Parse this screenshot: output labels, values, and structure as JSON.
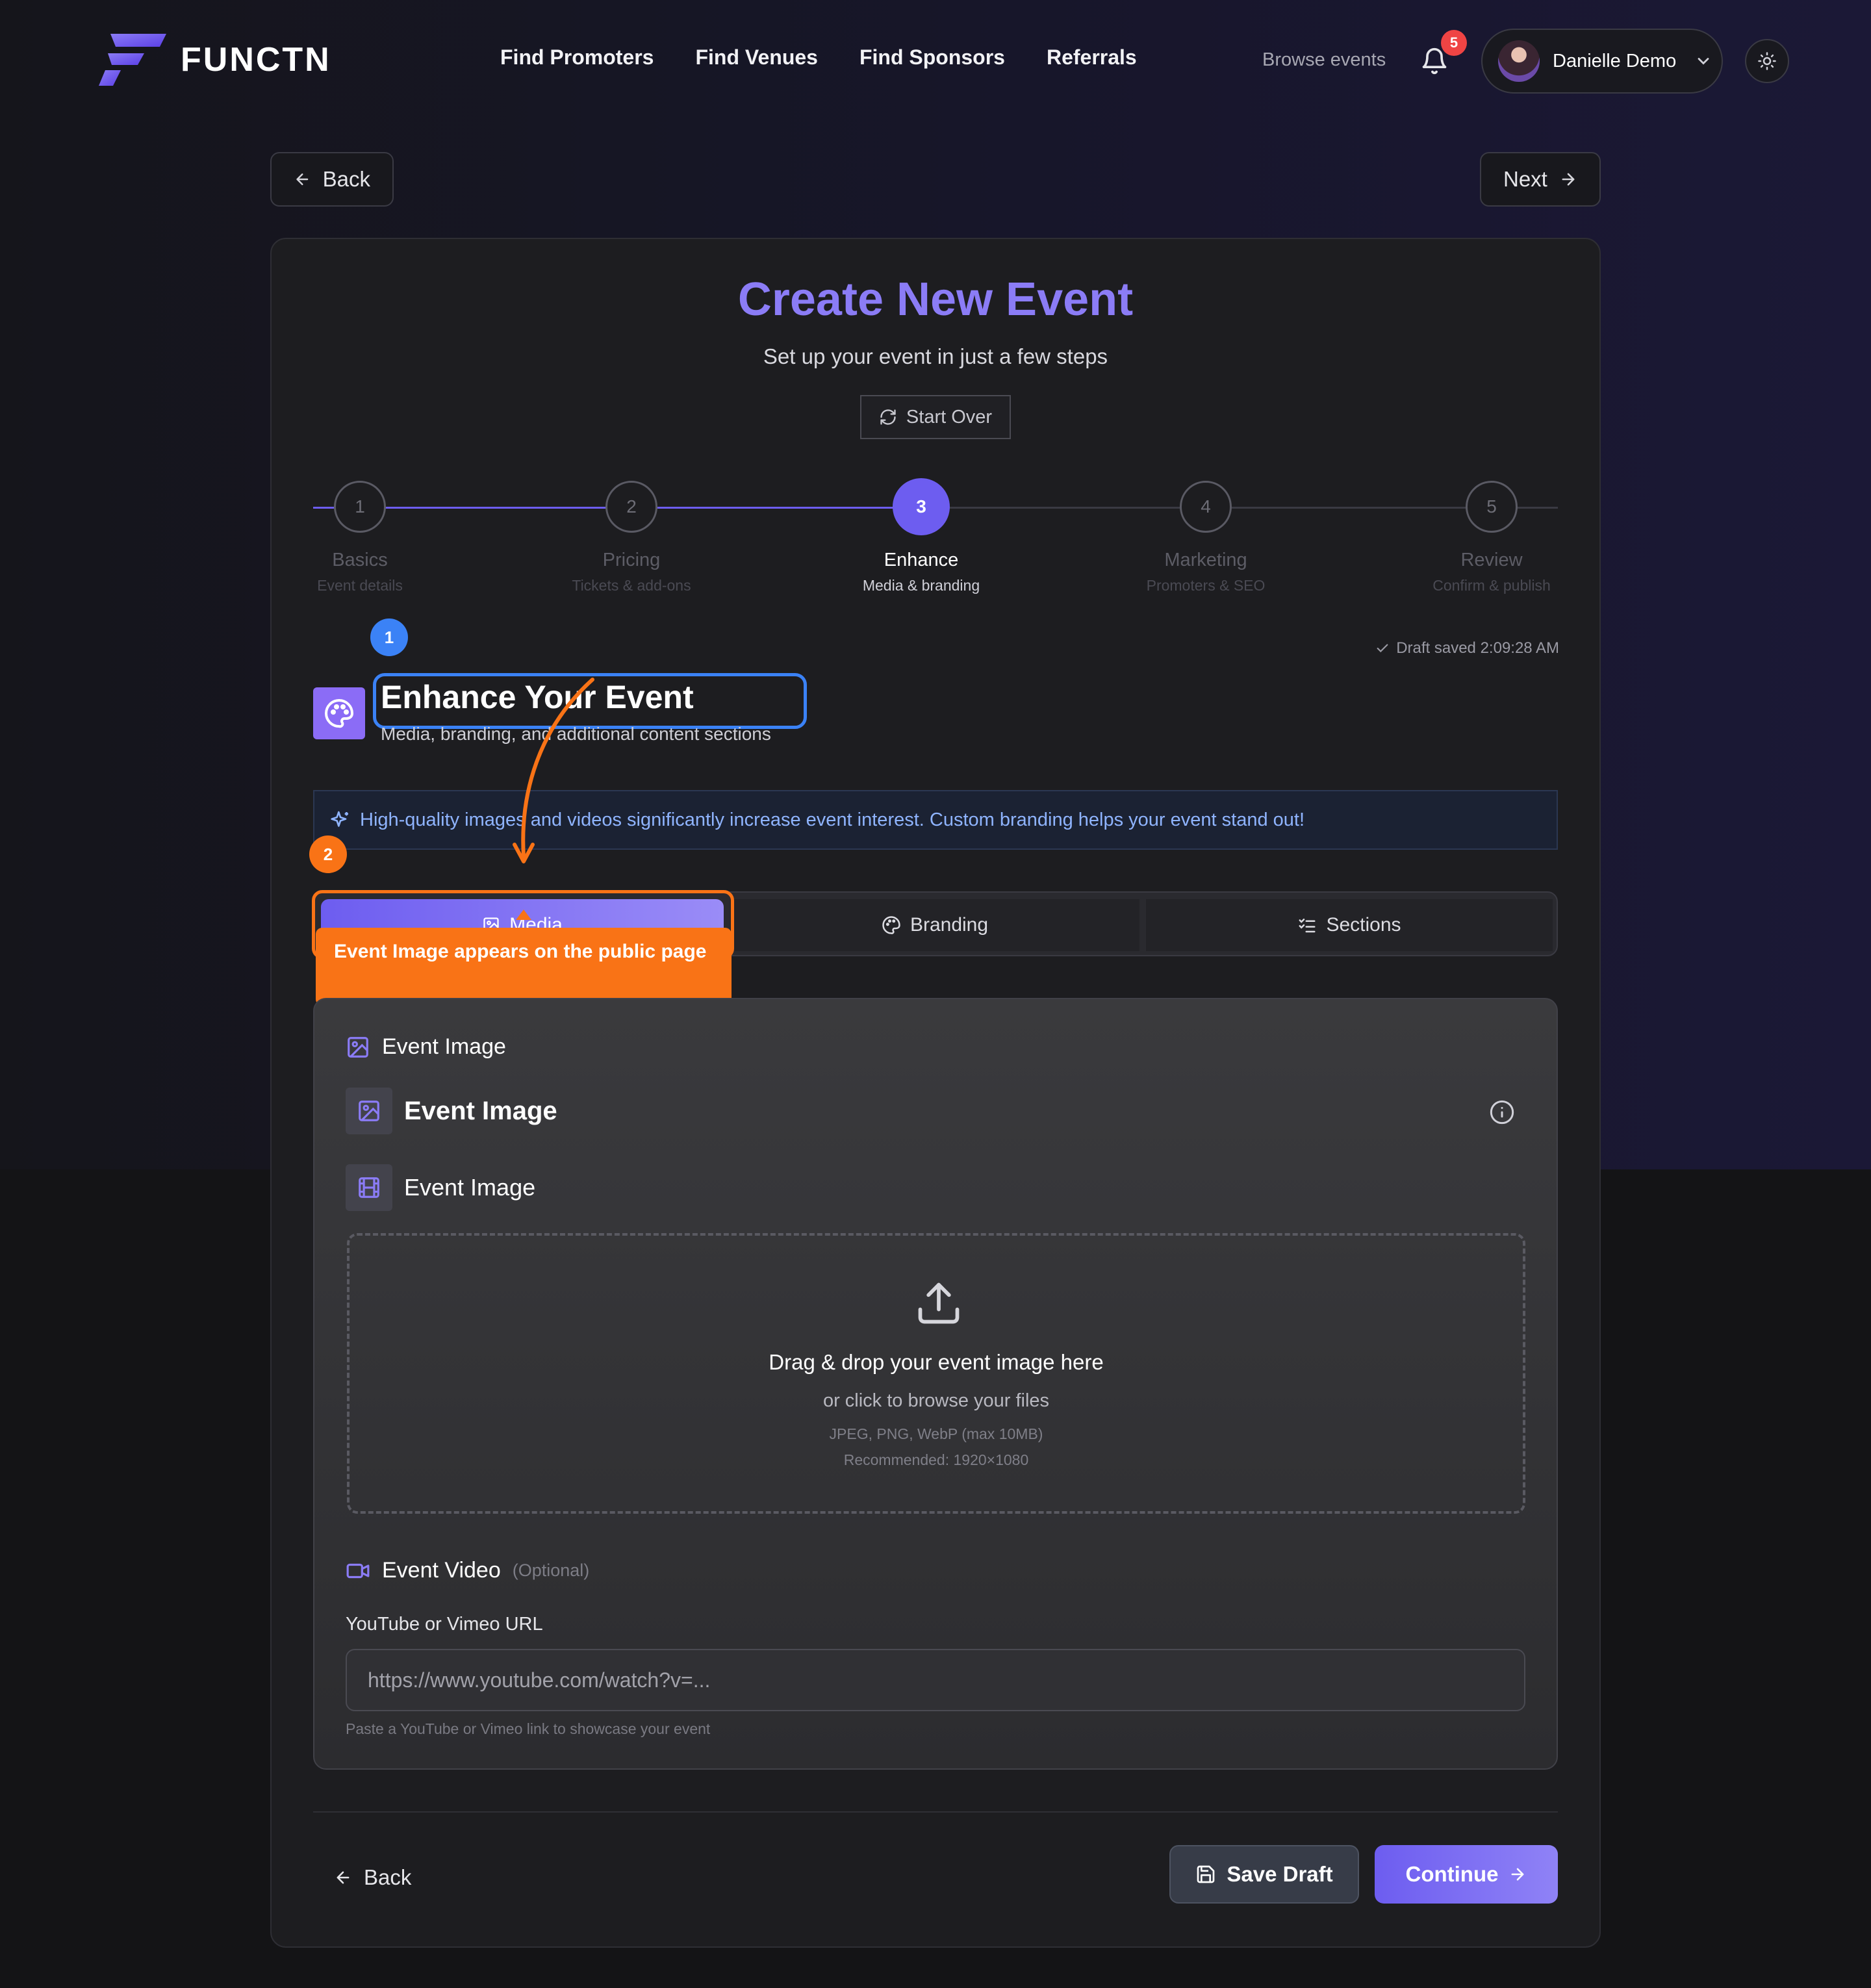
{
  "app": {
    "logo_text": "FUNCTN"
  },
  "nav": {
    "links": [
      "Find Promoters",
      "Find Venues",
      "Find Sponsors",
      "Referrals"
    ],
    "browse": "Browse events",
    "notifications_count": "5",
    "user_name": "Danielle Demo"
  },
  "top": {
    "back_label": "Back",
    "next_label": "Next"
  },
  "page": {
    "title": "Create New Event",
    "subtitle": "Set up your event in just a few steps",
    "start_over": "Start Over"
  },
  "steps": [
    {
      "num": "1",
      "label": "Basics",
      "sub": "Event details",
      "state": "completed"
    },
    {
      "num": "2",
      "label": "Pricing",
      "sub": "Tickets & add-ons",
      "state": "completed"
    },
    {
      "num": "3",
      "label": "Enhance",
      "sub": "Media & branding",
      "state": "active"
    },
    {
      "num": "4",
      "label": "Marketing",
      "sub": "Promoters & SEO",
      "state": "upcoming"
    },
    {
      "num": "5",
      "label": "Review",
      "sub": "Confirm & publish",
      "state": "upcoming"
    }
  ],
  "tour": {
    "marker_1": "1",
    "marker_2": "2",
    "tooltip": "Event Image appears on the public page"
  },
  "draft_saved": "Draft saved 2:09:28 AM",
  "section": {
    "title": "Enhance Your Event",
    "subtitle": "Media, branding, and additional content sections",
    "tip": "High-quality images and videos significantly increase event interest. Custom branding helps your event stand out!"
  },
  "tabs": {
    "media": "Media",
    "branding": "Branding",
    "sections": "Sections"
  },
  "media": {
    "image_heading": "Event Image",
    "image_title": "Event Image",
    "image_sub": "Event Image",
    "drop_title": "Drag & drop your event image here",
    "drop_sub": "or click to browse your files",
    "drop_formats": "JPEG, PNG, WebP (max 10MB)",
    "drop_recommended": "Recommended: 1920×1080",
    "video_heading": "Event Video",
    "video_optional": "(Optional)",
    "url_label": "YouTube or Vimeo URL",
    "url_placeholder": "https://www.youtube.com/watch?v=...",
    "url_value": "",
    "url_help": "Paste a YouTube or Vimeo link to showcase your event"
  },
  "footer": {
    "back_label": "Back",
    "save_draft": "Save Draft",
    "continue": "Continue"
  },
  "colors": {
    "accent": "#6d5df0",
    "title": "#8b7cf6",
    "tour_blue": "#3b82f6",
    "tour_orange": "#f97316",
    "badge": "#ef4444"
  }
}
